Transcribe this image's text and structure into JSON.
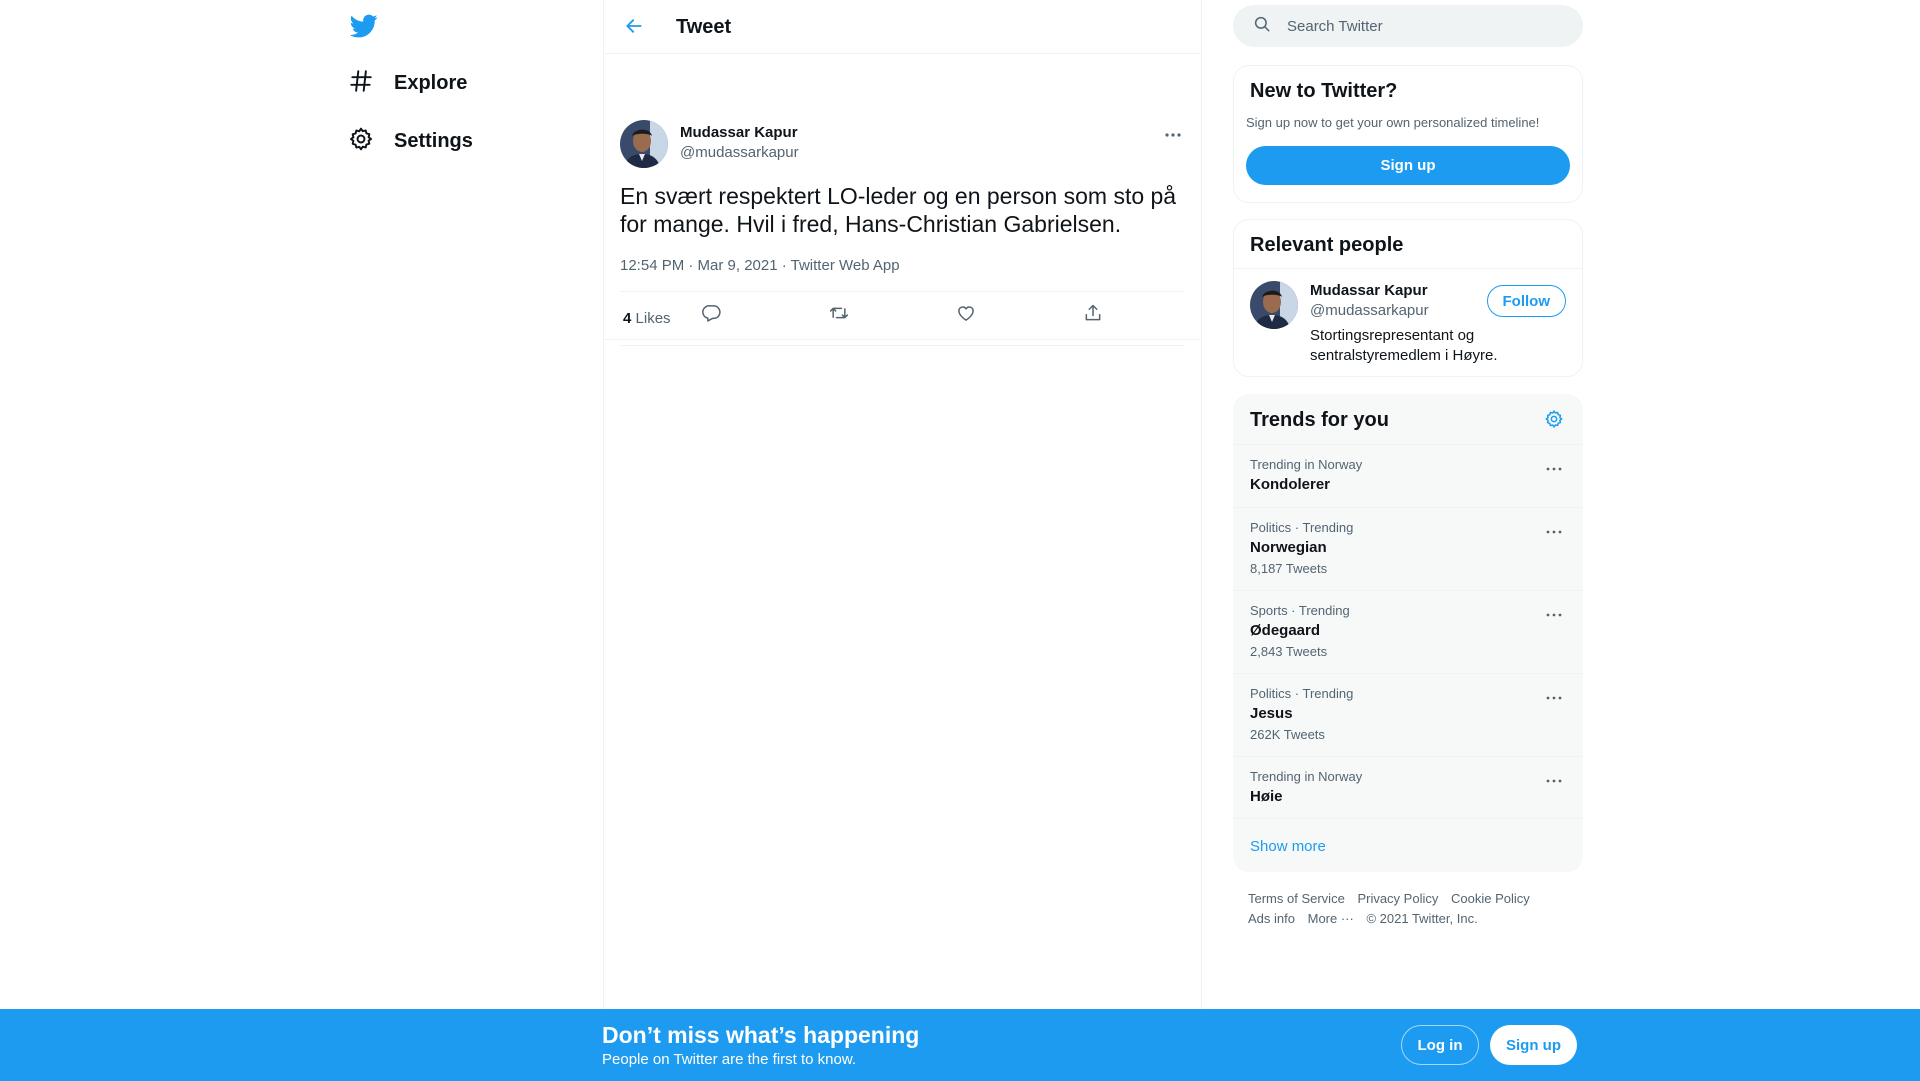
{
  "colors": {
    "accent": "#1d9bf0",
    "text": "#0f1419",
    "muted": "#536471",
    "border": "#eff3f4"
  },
  "nav": {
    "logo_icon": "twitter-bird-icon",
    "items": [
      {
        "label": "Explore",
        "icon": "hashtag-icon"
      },
      {
        "label": "Settings",
        "icon": "gear-icon"
      }
    ]
  },
  "header": {
    "title": "Tweet",
    "back_icon": "arrow-left-icon"
  },
  "tweet": {
    "author_name": "Mudassar Kapur",
    "author_handle": "@mudassarkapur",
    "text": "En svært respektert LO-leder og en person som sto på for mange. Hvil i fred, Hans-Christian Gabrielsen.",
    "meta": "12:54 PM · Mar 9, 2021 · Twitter Web App",
    "likes_count": "4",
    "likes_label": "Likes",
    "actions": [
      "reply-icon",
      "retweet-icon",
      "like-icon",
      "share-icon"
    ]
  },
  "search": {
    "placeholder": "Search Twitter"
  },
  "new_to_twitter": {
    "title": "New to Twitter?",
    "subtitle": "Sign up now to get your own personalized timeline!",
    "signup_label": "Sign up"
  },
  "relevant_people": {
    "title": "Relevant people",
    "person": {
      "name": "Mudassar Kapur",
      "handle": "@mudassarkapur",
      "bio": "Stortingsrepresentant og sentralstyremedlem i Høyre.",
      "follow_label": "Follow"
    }
  },
  "trends": {
    "title": "Trends for you",
    "items": [
      {
        "category": "Trending in Norway",
        "name": "Kondolerer",
        "count": ""
      },
      {
        "category": "Politics · Trending",
        "name": "Norwegian",
        "count": "8,187 Tweets"
      },
      {
        "category": "Sports · Trending",
        "name": "Ødegaard",
        "count": "2,843 Tweets"
      },
      {
        "category": "Politics · Trending",
        "name": "Jesus",
        "count": "262K Tweets"
      },
      {
        "category": "Trending in Norway",
        "name": "Høie",
        "count": ""
      }
    ],
    "show_more": "Show more"
  },
  "footer": {
    "links": [
      "Terms of Service",
      "Privacy Policy",
      "Cookie Policy",
      "Ads info",
      "More ···"
    ],
    "copyright": "© 2021 Twitter, Inc."
  },
  "bottom_bar": {
    "headline": "Don’t miss what’s happening",
    "subline": "People on Twitter are the first to know.",
    "login_label": "Log in",
    "signup_label": "Sign up"
  }
}
